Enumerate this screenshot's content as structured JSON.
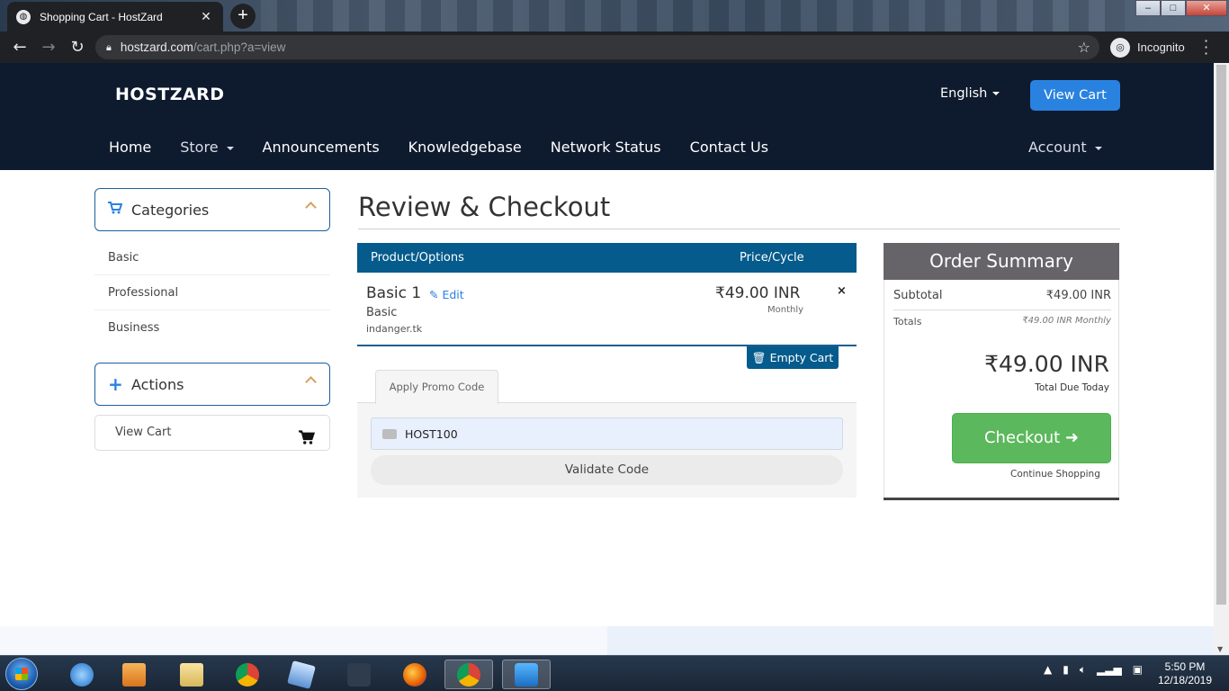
{
  "browser": {
    "tab_title": "Shopping Cart - HostZard",
    "new_tab": "+",
    "url_host": "hostzard.com",
    "url_path": "/cart.php?a=view",
    "profile_label": "Incognito"
  },
  "header": {
    "brand": "HOSTZARD",
    "language": "English",
    "view_cart": "View Cart",
    "nav": [
      "Home",
      "Store",
      "Announcements",
      "Knowledgebase",
      "Network Status",
      "Contact Us"
    ],
    "account": "Account"
  },
  "sidebar": {
    "categories_title": "Categories",
    "categories": [
      "Basic",
      "Professional",
      "Business"
    ],
    "actions_title": "Actions",
    "actions_view_cart": "View Cart"
  },
  "main": {
    "title": "Review & Checkout",
    "table_headers": {
      "product": "Product/Options",
      "price": "Price/Cycle"
    },
    "item": {
      "name": "Basic 1",
      "edit": "Edit",
      "group": "Basic",
      "domain": "indanger.tk",
      "price": "₹49.00 INR",
      "cycle": "Monthly",
      "remove": "×"
    },
    "empty_cart": "Empty Cart",
    "promo_tab": "Apply Promo Code",
    "promo_value": "HOST100",
    "validate": "Validate Code"
  },
  "summary": {
    "title": "Order Summary",
    "subtotal_label": "Subtotal",
    "subtotal_value": "₹49.00 INR",
    "totals_label": "Totals",
    "totals_value": "₹49.00 INR Monthly",
    "total_due": "₹49.00 INR",
    "total_due_label": "Total Due Today",
    "checkout": "Checkout",
    "continue": "Continue Shopping"
  },
  "taskbar": {
    "time": "5:50 PM",
    "date": "12/18/2019"
  }
}
